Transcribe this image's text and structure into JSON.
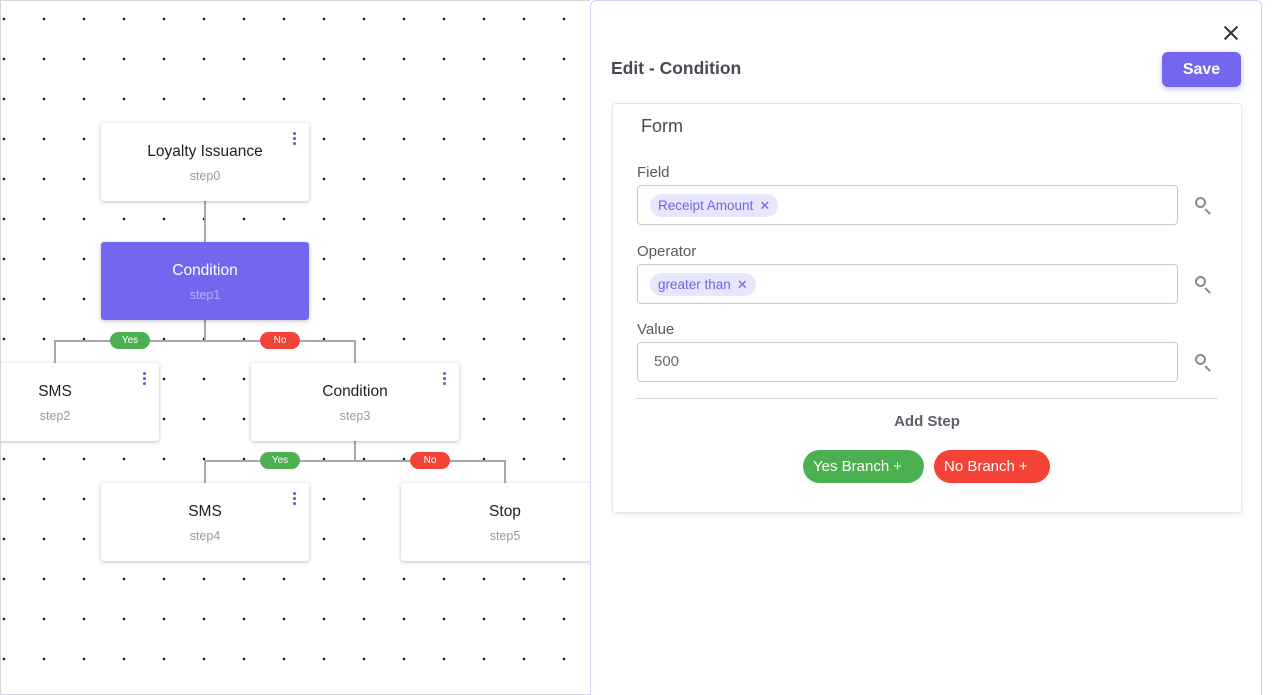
{
  "flow": {
    "nodes": [
      {
        "id": "loyalty-issuance",
        "title": "Loyalty Issuance",
        "step": "step0"
      },
      {
        "id": "condition-1",
        "title": "Condition",
        "step": "step1"
      },
      {
        "id": "sms-1",
        "title": "SMS",
        "step": "step2"
      },
      {
        "id": "condition-2",
        "title": "Condition",
        "step": "step3"
      },
      {
        "id": "sms-2",
        "title": "SMS",
        "step": "step4"
      },
      {
        "id": "stop",
        "title": "Stop",
        "step": "step5"
      }
    ],
    "branch_labels": {
      "yes": "Yes",
      "no": "No"
    }
  },
  "panel": {
    "title": "Edit - Condition",
    "save_label": "Save",
    "close_icon": "close-icon",
    "form": {
      "title": "Form",
      "field": {
        "label": "Field",
        "chip": "Receipt Amount"
      },
      "operator": {
        "label": "Operator",
        "chip": "greater than"
      },
      "value": {
        "label": "Value",
        "value": "500"
      },
      "add_step_label": "Add Step",
      "yes_branch_label": "Yes Branch",
      "no_branch_label": "No Branch"
    }
  },
  "colors": {
    "accent": "#7367f0",
    "yes": "#4caf50",
    "no": "#f44336",
    "chip_bg": "#e8e6fc"
  }
}
